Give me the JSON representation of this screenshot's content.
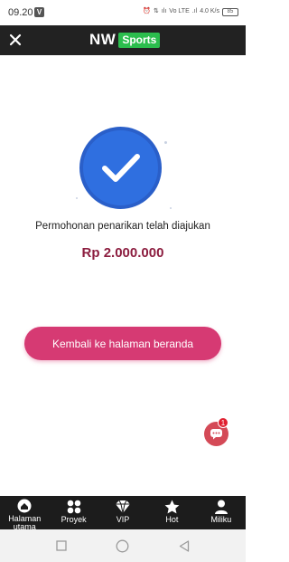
{
  "status_bar": {
    "time": "09.20",
    "app_icon": "V",
    "indicators": [
      "⏰",
      "⇅",
      "ılı",
      "Vo LTE",
      ".ıl",
      "4.0 K/s"
    ],
    "battery": "85"
  },
  "header": {
    "logo_text": "NW",
    "logo_badge": "Sports",
    "colors": {
      "background": "#222222",
      "badge": "#2bbd4d"
    }
  },
  "success": {
    "icon": "checkmark-icon",
    "message": "Permohonan penarikan telah diajukan",
    "amount": "Rp 2.000.000",
    "colors": {
      "circle": "#2f6fe0",
      "amount": "#8c1d3f"
    }
  },
  "actions": {
    "home_button_label": "Kembali ke halaman beranda",
    "button_color": "#d63a73"
  },
  "chat": {
    "icon": "chat-icon",
    "badge_count": "1"
  },
  "bottom_nav": {
    "items": [
      {
        "label": "Halaman utama",
        "icon": "home-icon"
      },
      {
        "label": "Proyek",
        "icon": "grid-icon"
      },
      {
        "label": "VIP",
        "icon": "diamond-icon"
      },
      {
        "label": "Hot",
        "icon": "star-icon"
      },
      {
        "label": "Miliku",
        "icon": "user-icon"
      }
    ]
  },
  "system_nav": {
    "buttons": [
      "recent-apps",
      "home",
      "back"
    ]
  }
}
